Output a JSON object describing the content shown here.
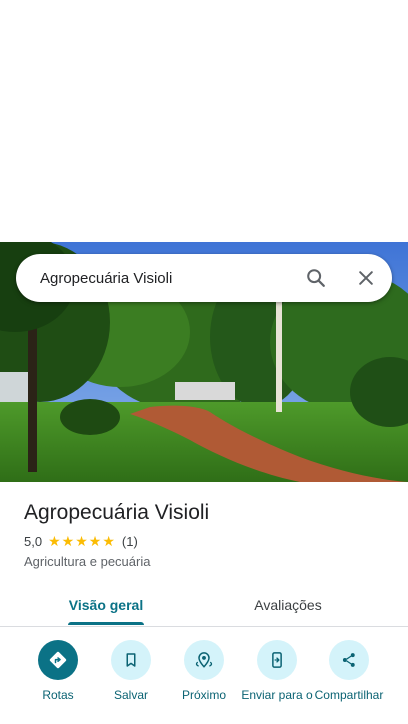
{
  "search": {
    "query": "Agropecuária Visioli"
  },
  "place": {
    "name": "Agropecuária Visioli",
    "rating": "5,0",
    "stars": [
      "★",
      "★",
      "★",
      "★",
      "★"
    ],
    "review_count": "(1)",
    "category": "Agricultura e pecuária"
  },
  "tabs": [
    {
      "label": "Visão geral",
      "selected": true
    },
    {
      "label": "Avaliações",
      "selected": false
    }
  ],
  "actions": [
    {
      "label": "Rotas",
      "icon": "directions-icon"
    },
    {
      "label": "Salvar",
      "icon": "bookmark-icon"
    },
    {
      "label": "Próximo",
      "icon": "nearby-icon"
    },
    {
      "label": "Enviar para o",
      "icon": "send-to-phone-icon"
    },
    {
      "label": "Compartilhar",
      "icon": "share-icon"
    }
  ],
  "colors": {
    "accent": "#0b7286",
    "action_bg": "#d4f3fa",
    "star": "#fbbc04"
  }
}
